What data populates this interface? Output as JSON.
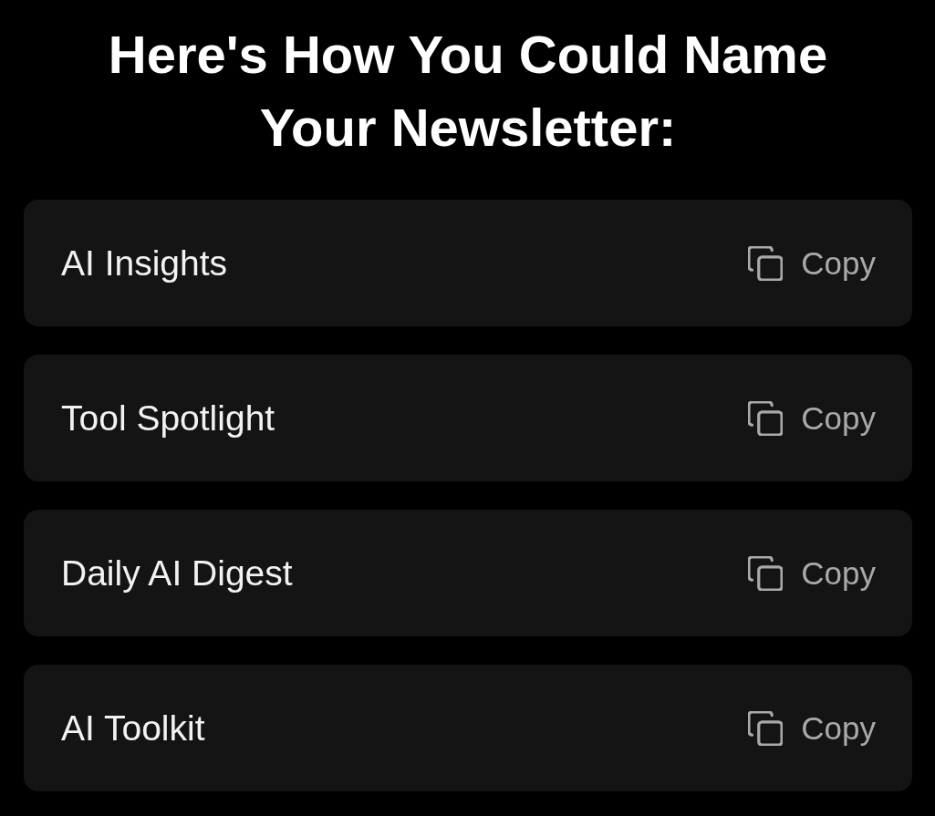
{
  "title": "Here's How You Could Name Your Newsletter:",
  "suggestions": [
    {
      "name": "AI Insights",
      "action": "Copy"
    },
    {
      "name": "Tool Spotlight",
      "action": "Copy"
    },
    {
      "name": "Daily AI Digest",
      "action": "Copy"
    },
    {
      "name": "AI Toolkit",
      "action": "Copy"
    }
  ]
}
